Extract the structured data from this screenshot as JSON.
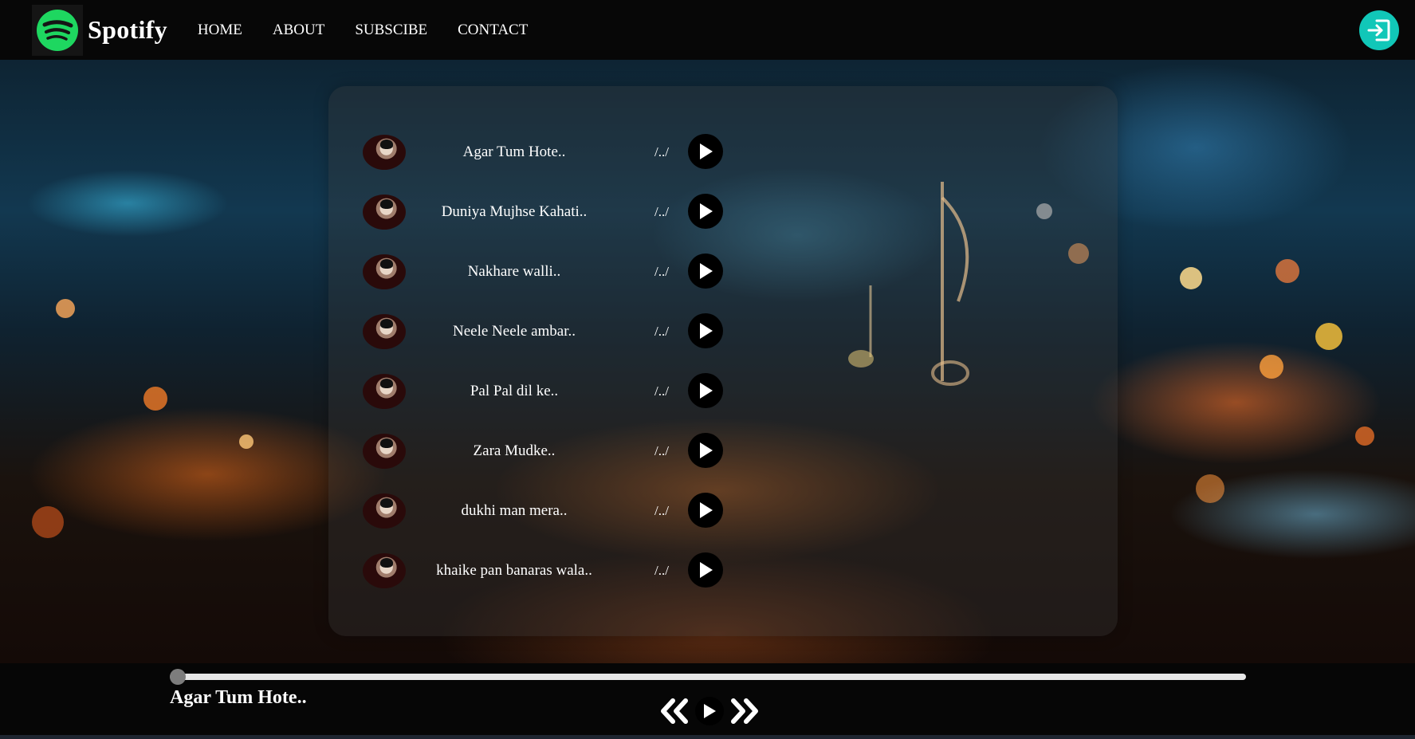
{
  "brand": {
    "name": "Spotify",
    "logo_icon": "spotify-logo-icon",
    "logo_color": "#1ed760"
  },
  "nav": {
    "items": [
      "HOME",
      "ABOUT",
      "SUBSCIBE",
      "CONTACT"
    ]
  },
  "header": {
    "login_icon": "login-icon",
    "login_color": "#11c7b8"
  },
  "songs": [
    {
      "title": "Agar Tum Hote..",
      "time": "/../"
    },
    {
      "title": "Duniya Mujhse Kahati..",
      "time": "/../"
    },
    {
      "title": "Nakhare walli..",
      "time": "/../"
    },
    {
      "title": "Neele Neele ambar..",
      "time": "/../"
    },
    {
      "title": "Pal Pal dil ke..",
      "time": "/../"
    },
    {
      "title": "Zara Mudke..",
      "time": "/../"
    },
    {
      "title": "dukhi man mera..",
      "time": "/../"
    },
    {
      "title": "khaike pan banaras wala..",
      "time": "/../"
    }
  ],
  "player": {
    "now_playing": "Agar Tum Hote..",
    "progress": 0.0,
    "controls": [
      "previous-icon",
      "play-icon",
      "next-icon"
    ]
  }
}
